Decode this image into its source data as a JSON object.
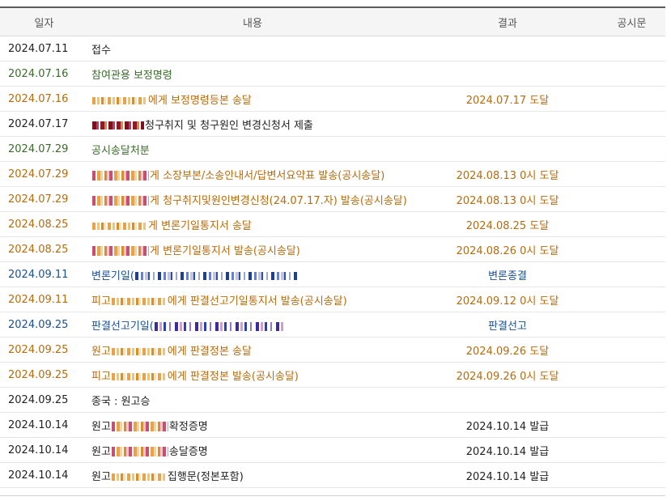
{
  "table": {
    "headers": {
      "date": "일자",
      "content": "내용",
      "result": "결과",
      "notice": "공시문"
    },
    "rows": [
      {
        "date": "2024.07.11",
        "pre": "접수",
        "redact": "",
        "post": "",
        "result": "",
        "color": "black"
      },
      {
        "date": "2024.07.16",
        "pre": "참여관용 보정명령",
        "redact": "",
        "post": "",
        "result": "",
        "color": "green"
      },
      {
        "date": "2024.07.16",
        "pre": "",
        "redact": "orange",
        "post": "에게 보정명령등본 송달",
        "result": "2024.07.17 도달",
        "color": "orange"
      },
      {
        "date": "2024.07.17",
        "pre": "",
        "redact": "maroon",
        "post": "청구취지 및 청구원인 변경신청서 제출",
        "result": "",
        "color": "black"
      },
      {
        "date": "2024.07.29",
        "pre": "공시송달처분",
        "redact": "",
        "post": "",
        "result": "",
        "color": "green"
      },
      {
        "date": "2024.07.29",
        "pre": "",
        "redact": "mixed",
        "post": "게 소장부본/소송안내서/답변서요약표 발송(공시송달)",
        "result": "2024.08.13 0시 도달",
        "color": "orange"
      },
      {
        "date": "2024.07.29",
        "pre": "",
        "redact": "mixed",
        "post": "게 청구취지및원인변경신청(24.07.17.자) 발송(공시송달)",
        "result": "2024.08.13 0시 도달",
        "color": "orange"
      },
      {
        "date": "2024.08.25",
        "pre": "",
        "redact": "orange",
        "post": "게 변론기일통지서 송달",
        "result": "2024.08.25 도달",
        "color": "orange"
      },
      {
        "date": "2024.08.25",
        "pre": "",
        "redact": "mixed",
        "post": "게 변론기일통지서 발송(공시송달)",
        "result": "2024.08.26 0시 도달",
        "color": "orange"
      },
      {
        "date": "2024.09.11",
        "pre": "변론기일(",
        "redact": "blue",
        "post": "",
        "result": "변론종결",
        "color": "blue"
      },
      {
        "date": "2024.09.11",
        "pre": "피고",
        "redact": "orange",
        "post": "에게 판결선고기일통지서 발송(공시송달)",
        "result": "2024.09.12 0시 도달",
        "color": "orange"
      },
      {
        "date": "2024.09.25",
        "pre": "판결선고기일(",
        "redact": "purple",
        "post": "",
        "result": "판결선고",
        "color": "blue"
      },
      {
        "date": "2024.09.25",
        "pre": "원고",
        "redact": "orange",
        "post": "에게 판결정본 송달",
        "result": "2024.09.26 도달",
        "color": "orange"
      },
      {
        "date": "2024.09.25",
        "pre": "피고",
        "redact": "orange",
        "post": "에게 판결정본 발송(공시송달)",
        "result": "2024.09.26 0시 도달",
        "color": "orange"
      },
      {
        "date": "2024.09.25",
        "pre": "종국 : 원고승",
        "redact": "",
        "post": "",
        "result": "",
        "color": "black"
      },
      {
        "date": "2024.10.14",
        "pre": "원고",
        "redact": "mixed",
        "post": "확정증명",
        "result": "2024.10.14 발급",
        "color": "black"
      },
      {
        "date": "2024.10.14",
        "pre": "원고",
        "redact": "mixed",
        "post": "송달증명",
        "result": "2024.10.14 발급",
        "color": "black"
      },
      {
        "date": "2024.10.14",
        "pre": "원고",
        "redact": "orange",
        "post": "집행문(정본포함)",
        "result": "2024.10.14 발급",
        "color": "black"
      }
    ]
  },
  "colors": {
    "black": "#222222",
    "green": "#3b6b2c",
    "orange": "#b86b0c",
    "blue": "#1a4f94",
    "header_bg": "#f5f5f5"
  }
}
